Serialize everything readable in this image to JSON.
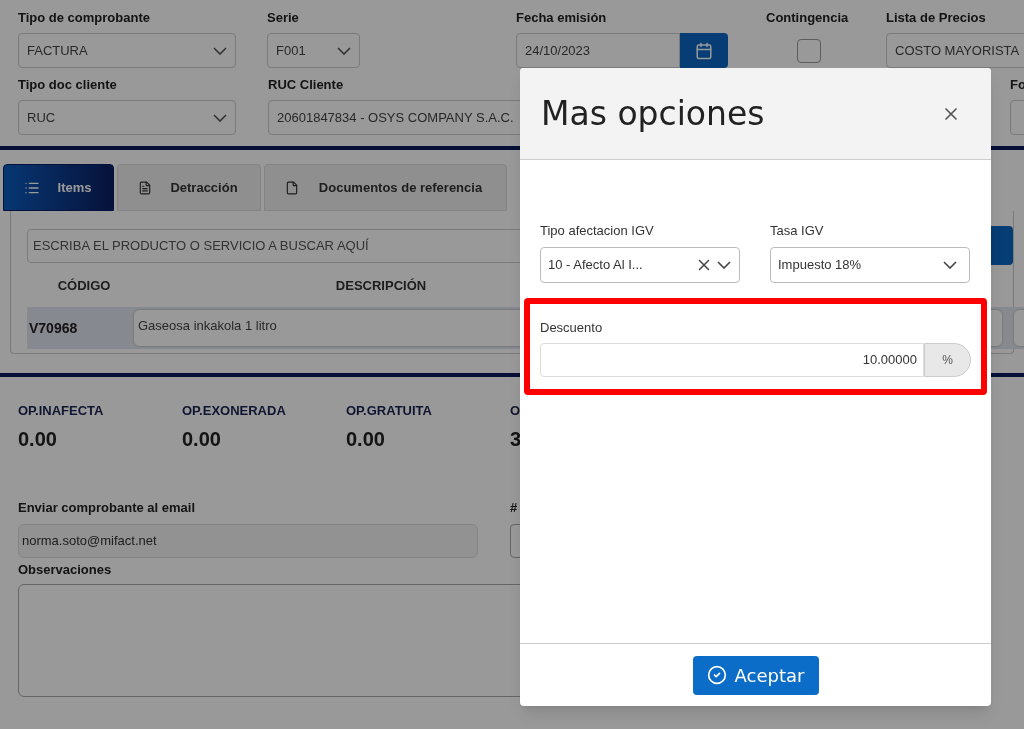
{
  "form": {
    "row1": [
      {
        "kind": "select",
        "label": "Tipo de comprobante",
        "value": "FACTURA"
      },
      {
        "kind": "select",
        "label": "Serie",
        "value": "F001"
      },
      {
        "kind": "date",
        "label": "Fecha emisión",
        "value": "24/10/2023"
      },
      {
        "kind": "checkbox",
        "label": "Contingencia",
        "checked": false
      },
      {
        "kind": "text",
        "label": "Lista de Precios",
        "value": "COSTO MAYORISTA"
      }
    ],
    "row2": [
      {
        "kind": "select",
        "label": "Tipo doc cliente",
        "value": "RUC"
      },
      {
        "kind": "text",
        "label": "RUC Cliente",
        "value": "20601847834 - OSYS COMPANY S.A.C."
      },
      {
        "kind": "text",
        "label": "Fo"
      }
    ]
  },
  "tabs": [
    {
      "label": "Items",
      "selected": true
    },
    {
      "label": "Detracción",
      "selected": false
    },
    {
      "label": "Documentos de referencia",
      "selected": false
    }
  ],
  "items": {
    "search": {
      "placeholder": "ESCRIBA EL PRODUCTO O SERVICIO A BUSCAR AQUÍ"
    },
    "columns": [
      "CÓDIGO",
      "DESCRIPCIÓN"
    ],
    "rows": [
      {
        "code": "V70968",
        "description": "Gaseosa inkakola 1 litro"
      }
    ]
  },
  "totals": [
    {
      "label": "OP.INAFECTA",
      "value": "0.00"
    },
    {
      "label": "OP.EXONERADA",
      "value": "0.00"
    },
    {
      "label": "OP.GRATUITA",
      "value": "0.00"
    },
    {
      "label": "O",
      "value": "3"
    }
  ],
  "email": {
    "label": "Enviar comprobante al email",
    "value": "norma.soto@mifact.net"
  },
  "column_right": {
    "label": "#"
  },
  "observaciones": {
    "label": "Observaciones"
  },
  "modal": {
    "title": "Mas opciones",
    "tipo_afectacion": {
      "label": "Tipo afectacion IGV",
      "value": "10 - Afecto Al I...",
      "clearable": true
    },
    "tasa": {
      "label": "Tasa IGV",
      "value": "Impuesto 18%"
    },
    "descuento": {
      "label": "Descuento",
      "value": "10.00000",
      "addon": "%",
      "highlighted": true
    },
    "button": "Aceptar"
  }
}
